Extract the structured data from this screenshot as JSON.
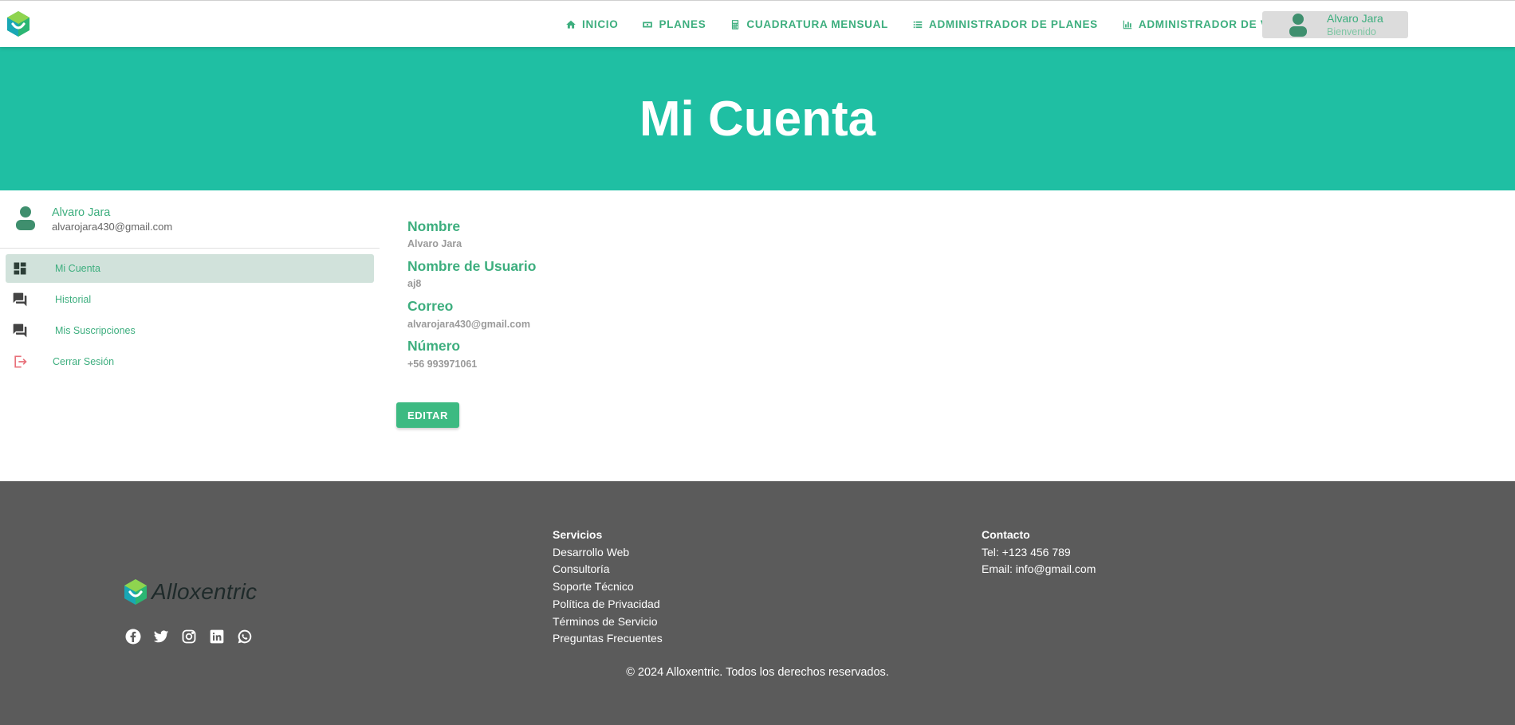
{
  "nav": {
    "items": [
      {
        "label": "INICIO",
        "icon": "home-icon"
      },
      {
        "label": "PLANES",
        "icon": "money-icon"
      },
      {
        "label": "CUADRATURA MENSUAL",
        "icon": "calculator-icon"
      },
      {
        "label": "ADMINISTRADOR DE PLANES",
        "icon": "list-icon"
      },
      {
        "label": "ADMINISTRADOR DE VENTAS",
        "icon": "bar-chart-icon"
      }
    ],
    "user": {
      "name": "Alvaro Jara",
      "greeting": "Bienvenido"
    }
  },
  "hero": {
    "title": "Mi Cuenta"
  },
  "sidebar": {
    "user_name": "Alvaro Jara",
    "user_email": "alvarojara430@gmail.com",
    "items": [
      {
        "label": "Mi Cuenta",
        "icon": "dashboard-icon",
        "active": true
      },
      {
        "label": "Historial",
        "icon": "chat-icon",
        "active": false
      },
      {
        "label": "Mis Suscripciones",
        "icon": "chat-icon",
        "active": false
      },
      {
        "label": "Cerrar Sesión",
        "icon": "logout-icon",
        "active": false
      }
    ]
  },
  "account": {
    "name_label": "Nombre",
    "name_value": "Alvaro Jara",
    "username_label": "Nombre de Usuario",
    "username_value": "aj8",
    "email_label": "Correo",
    "email_value": "alvarojara430@gmail.com",
    "phone_label": "Número",
    "phone_value": "+56 993971061",
    "edit_label": "EDITAR"
  },
  "footer": {
    "brand": "Alloxentric",
    "socials": [
      "facebook-icon",
      "twitter-icon",
      "instagram-icon",
      "linkedin-icon",
      "whatsapp-icon"
    ],
    "services": {
      "heading": "Servicios",
      "links": [
        "Desarrollo Web",
        "Consultoría",
        "Soporte Técnico",
        "Política de Privacidad",
        "Términos de Servicio",
        "Preguntas Frecuentes"
      ]
    },
    "contact": {
      "heading": "Contacto",
      "phone": "Tel: +123 456 789",
      "email": "Email: info@gmail.com"
    },
    "copyright": "© 2024 Alloxentric. Todos los derechos reservados."
  },
  "colors": {
    "accent": "#3dae7e",
    "hero": "#1fbfa3",
    "footer": "#5b5b5b",
    "active_item": "#d1e2db",
    "logout": "#e8707a"
  }
}
